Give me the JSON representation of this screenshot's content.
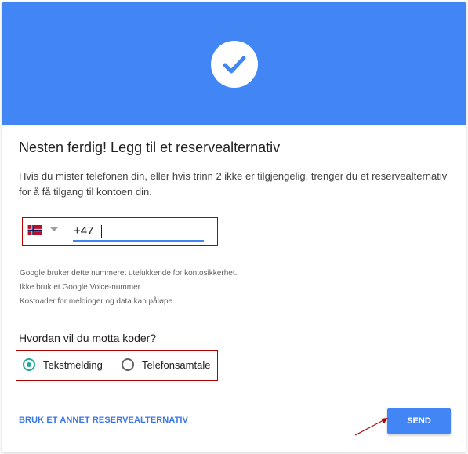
{
  "colors": {
    "banner": "#4285f4",
    "accent": "#4285f4",
    "radio_checked": "#26a69a",
    "annotation": "#b00000"
  },
  "banner": {
    "icon": "checkmark-icon"
  },
  "title": "Nesten ferdig! Legg til et reservealternativ",
  "description": "Hvis du mister telefonen din, eller hvis trinn 2 ikke er tilgjengelig, trenger du et reservealternativ for å få tilgang til kontoen din.",
  "phone": {
    "country_flag": "norway-flag-icon",
    "dropdown_icon": "dropdown-arrow-icon",
    "value": "+47"
  },
  "notes": [
    "Google bruker dette nummeret utelukkende for kontosikkerhet.",
    "Ikke bruk et Google Voice-nummer.",
    "Kostnader for meldinger og data kan påløpe."
  ],
  "question": "Hvordan vil du motta koder?",
  "options": [
    {
      "label": "Tekstmelding",
      "selected": true
    },
    {
      "label": "Telefonsamtale",
      "selected": false
    }
  ],
  "actions": {
    "alt_label": "BRUK ET ANNET RESERVEALTERNATIV",
    "send_label": "SEND"
  }
}
